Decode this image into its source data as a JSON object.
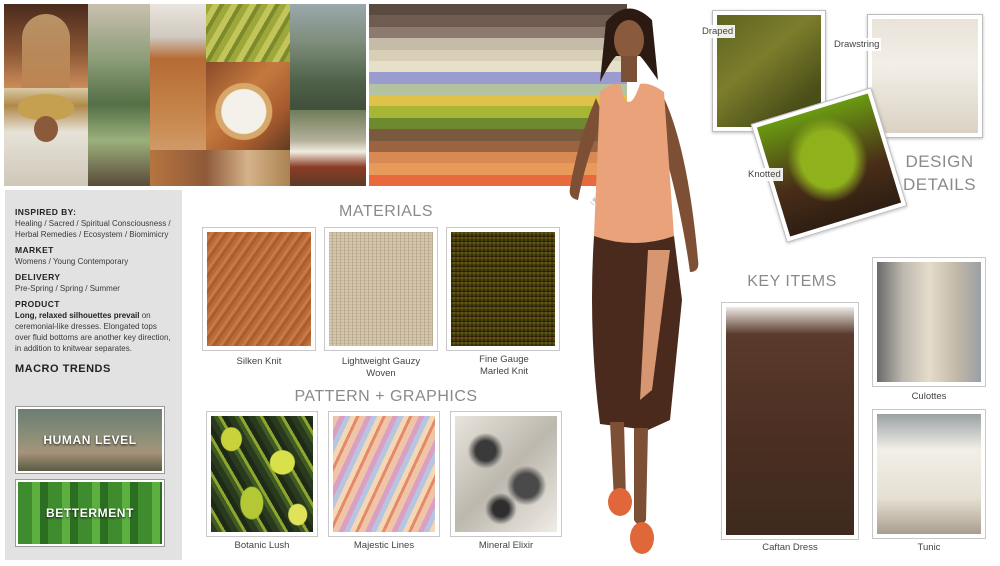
{
  "collage": {
    "items": [
      "arch",
      "hat-model",
      "botanic-window",
      "runway-model",
      "leaf-pattern",
      "herbs-mortar",
      "rock-carving",
      "mountain-temple"
    ]
  },
  "palette": {
    "colors": [
      "#5a4a40",
      "#6f5b50",
      "#8c7a6e",
      "#c4bca8",
      "#d8cfb6",
      "#e6e0c8",
      "#9a9cd0",
      "#b3c2a0",
      "#e0c24a",
      "#a7b634",
      "#6e8a2e",
      "#7a5a3e",
      "#9a6440",
      "#d98a54",
      "#e79a5a",
      "#e86a3c"
    ]
  },
  "info": {
    "inspired_heading": "INSPIRED BY:",
    "inspired_text": "Healing / Sacred / Spiritual Consciousness / Herbal Remedies / Ecosystem / Biomimicry",
    "market_heading": "MARKET",
    "market_text": "Womens / Young Contemporary",
    "delivery_heading": "DELIVERY",
    "delivery_text": "Pre-Spring / Spring / Summer",
    "product_heading": "PRODUCT",
    "product_lead": "Long, relaxed silhouettes prevail",
    "product_text": " on ceremonial-like dresses. Elongated tops over fluid bottoms are another key direction, in addition to knitwear separates.",
    "macro_heading": "MACRO TRENDS",
    "trends": [
      "HUMAN LEVEL",
      "BETTERMENT"
    ]
  },
  "materials": {
    "title": "MATERIALS",
    "items": [
      {
        "label": "Silken Knit"
      },
      {
        "label": "Lightweight Gauzy Woven"
      },
      {
        "label": "Fine Gauge Marled Knit"
      }
    ]
  },
  "patterns": {
    "title": "PATTERN + GRAPHICS",
    "items": [
      {
        "label": "Botanic Lush"
      },
      {
        "label": "Majestic Lines"
      },
      {
        "label": "Mineral Elixir"
      }
    ]
  },
  "design_details": {
    "title_line1": "DESIGN",
    "title_line2": "DETAILS",
    "items": [
      {
        "label": "Draped"
      },
      {
        "label": "Drawstring"
      },
      {
        "label": "Knotted"
      }
    ]
  },
  "key_items": {
    "title": "KEY ITEMS",
    "items": [
      {
        "label": "Caftan Dress"
      },
      {
        "label": "Culottes"
      },
      {
        "label": "Tunic"
      }
    ]
  }
}
